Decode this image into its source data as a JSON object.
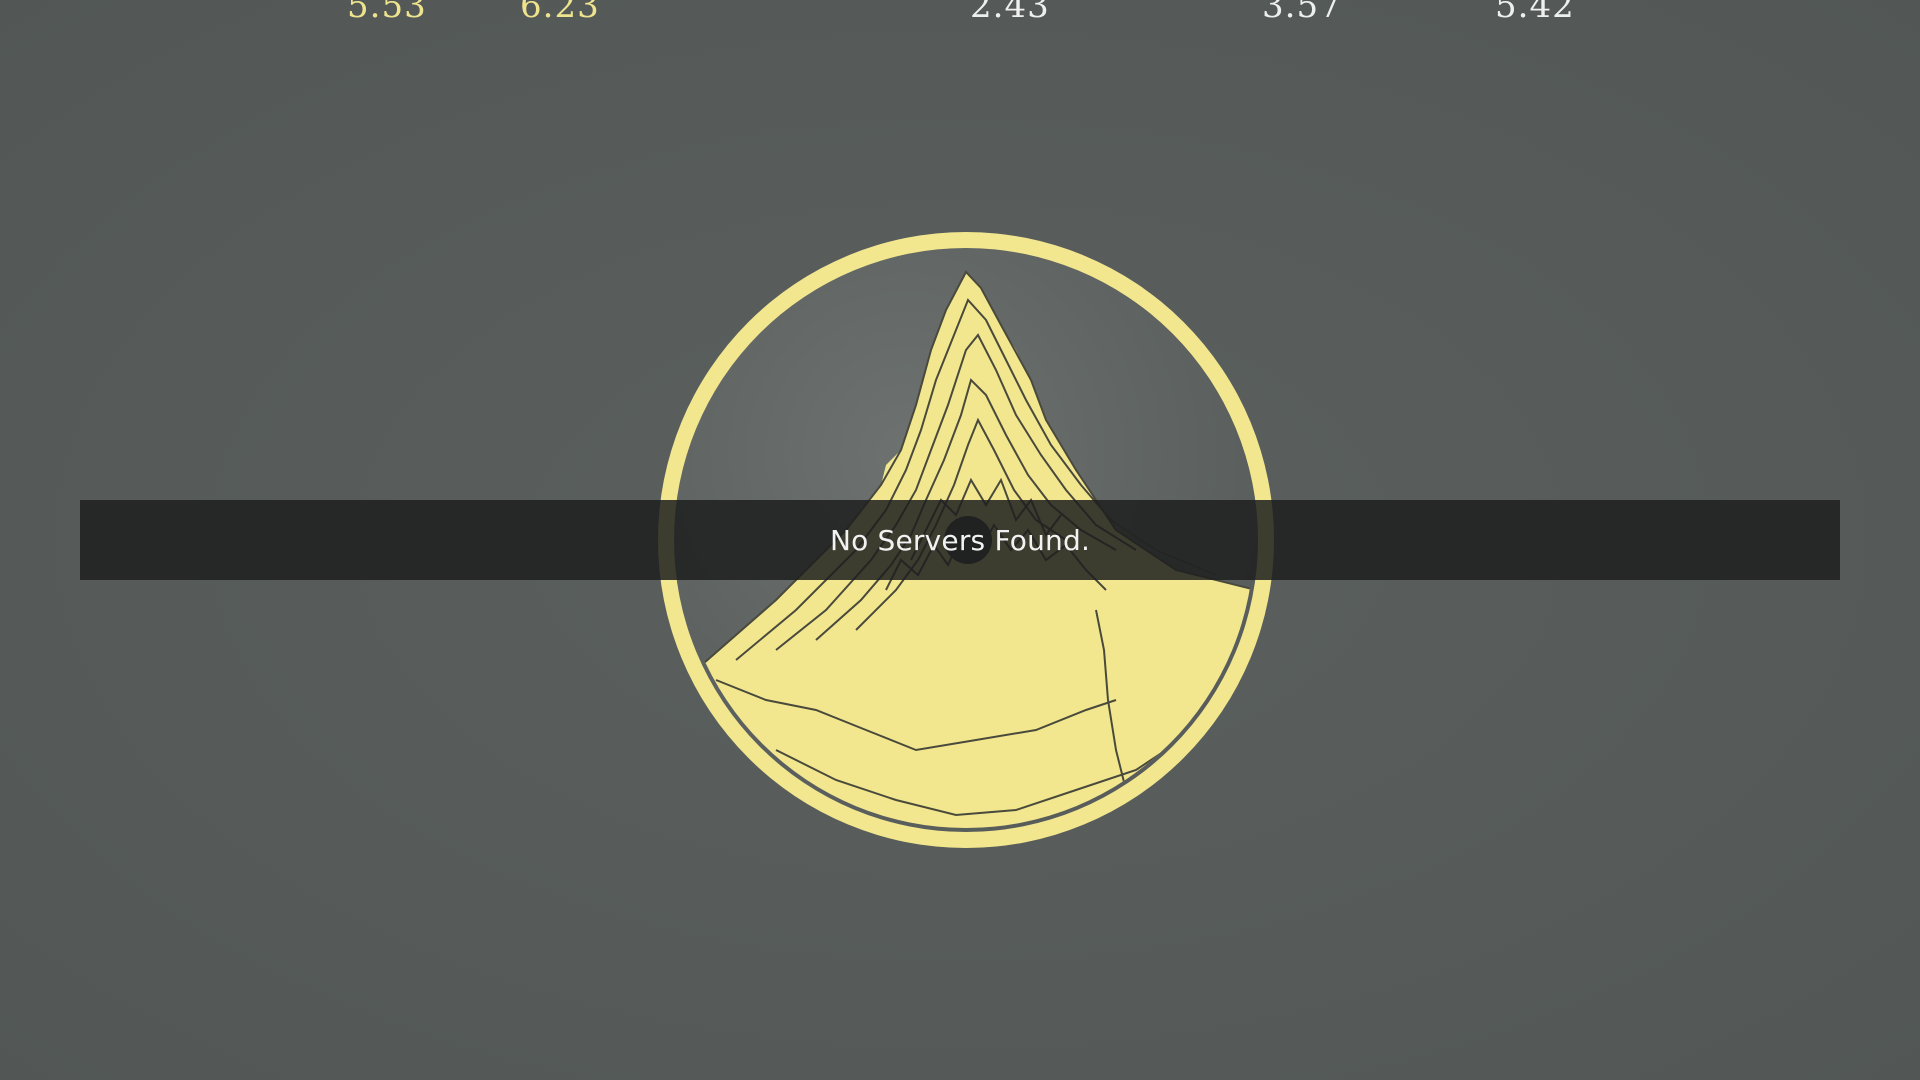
{
  "durations": {
    "first": "5.53",
    "second": "6.23",
    "third": "2.43",
    "fourth": "3.57",
    "fifth": "5.42"
  },
  "artwork": {
    "icon": "album-art-mountain-disc",
    "colors": {
      "disc": "#f2e78f",
      "sky": "#5e6361",
      "line": "#4a4a3c"
    }
  },
  "notice": {
    "message": "No Servers Found."
  },
  "colors": {
    "background": "#565b59",
    "bar": "#1e1f1f",
    "text": "#f1f2f1"
  }
}
